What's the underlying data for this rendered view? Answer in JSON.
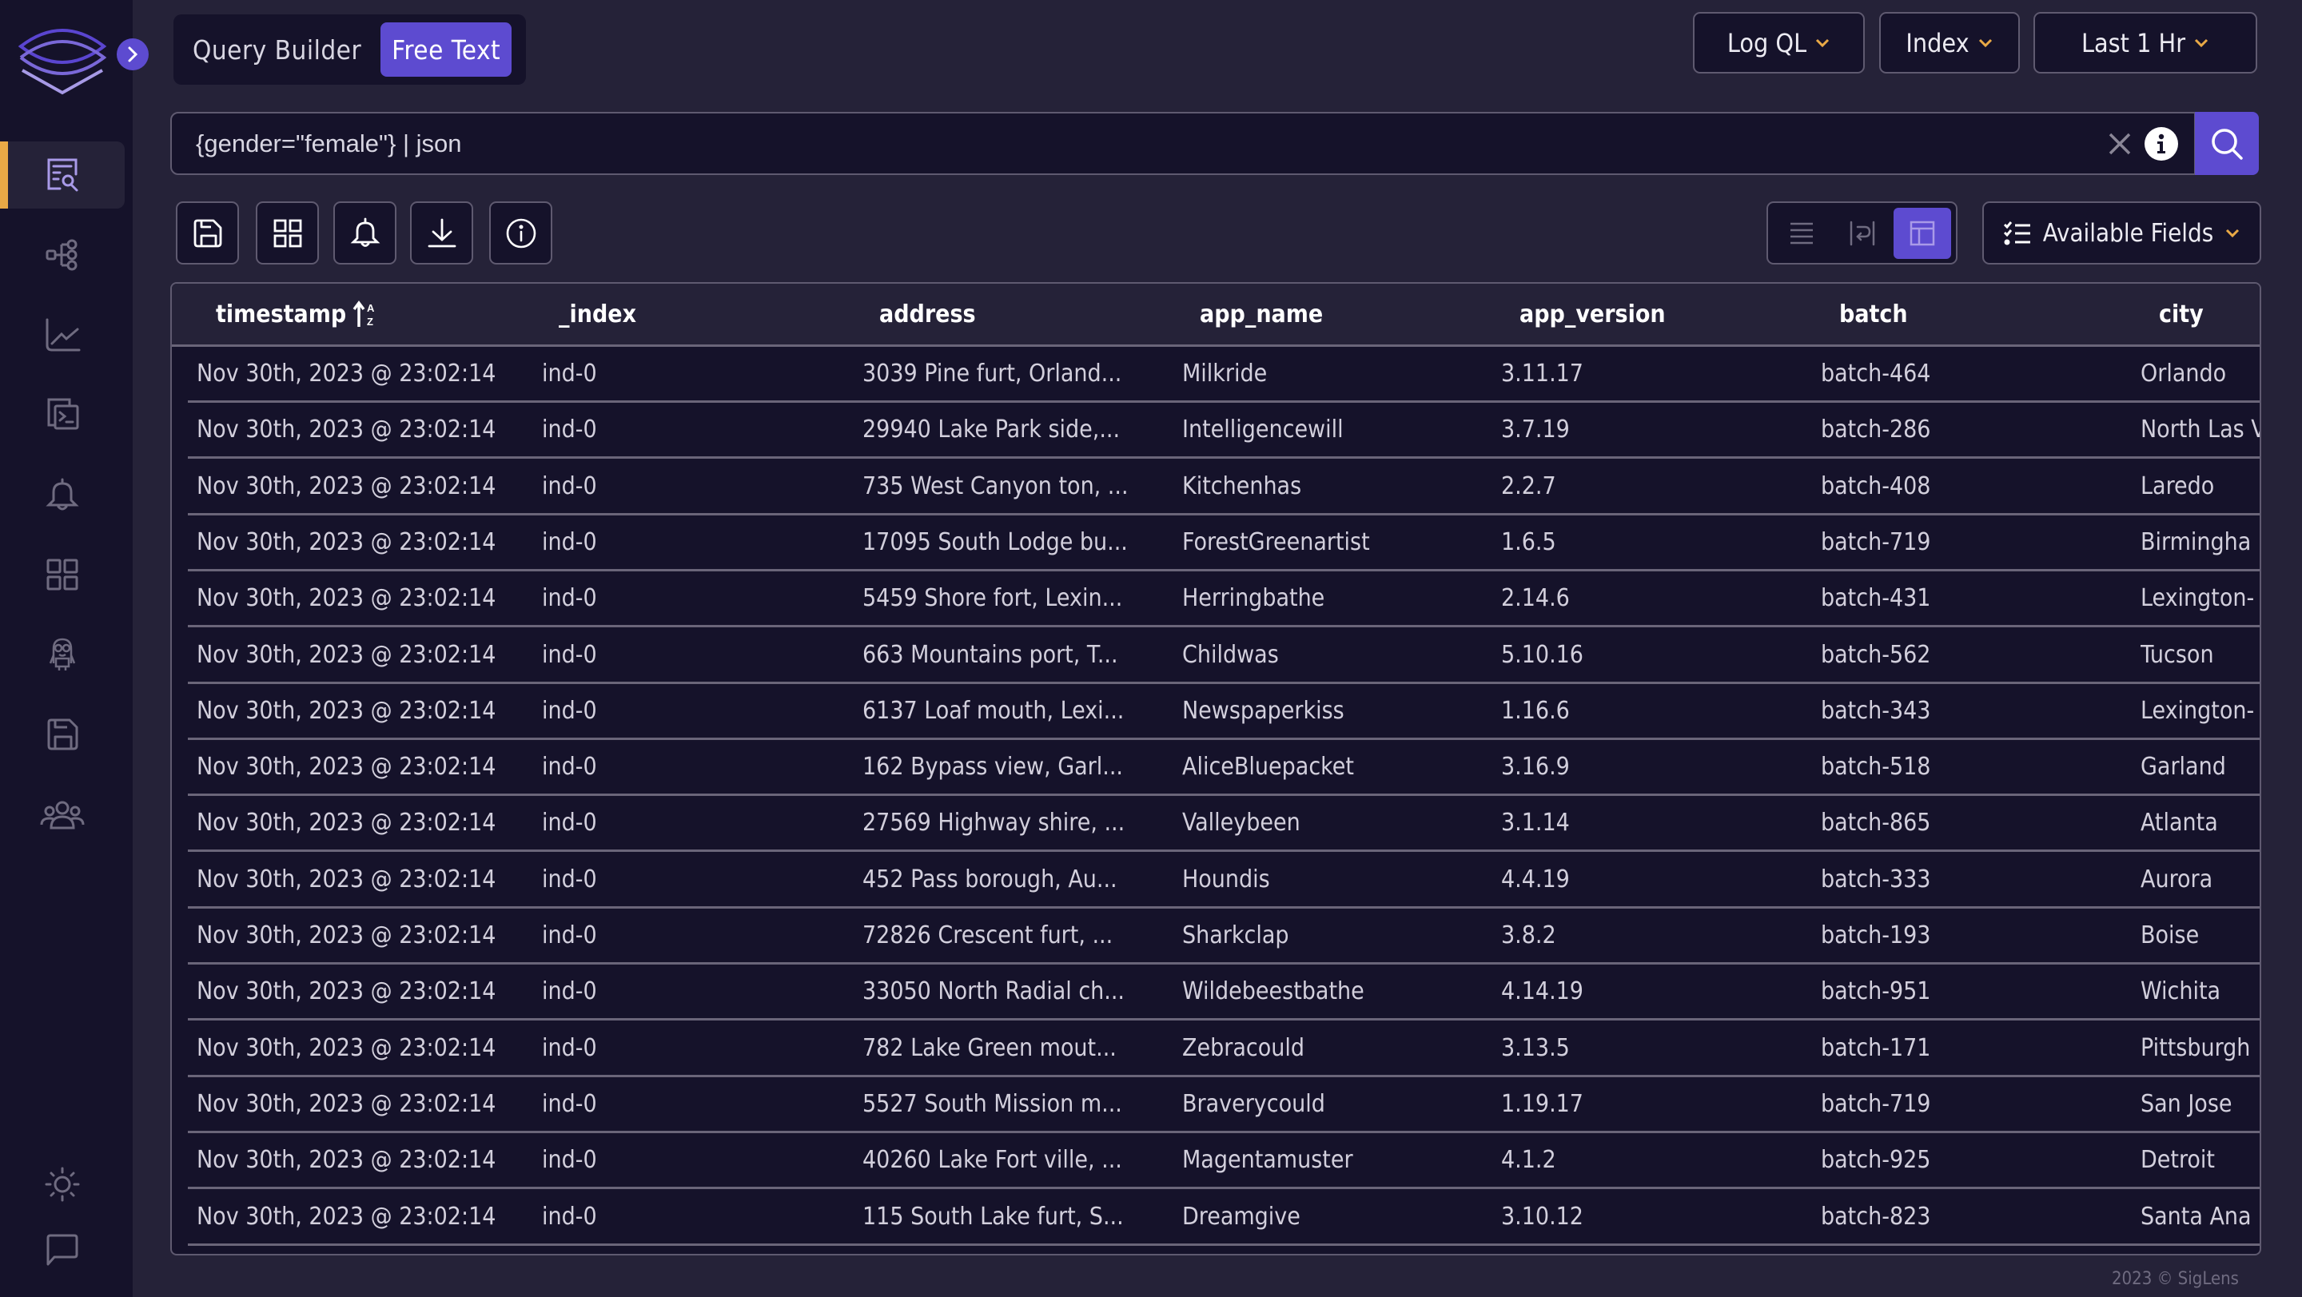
{
  "app": {
    "logo": "siglens-logo",
    "expand_icon": "chevron-right-icon"
  },
  "sidebar": {
    "items": [
      {
        "name": "logs-search",
        "icon": "log-search-icon",
        "active": true
      },
      {
        "name": "service-map",
        "icon": "service-tree-icon",
        "active": false
      },
      {
        "name": "metrics",
        "icon": "line-chart-icon",
        "active": false
      },
      {
        "name": "live-tail",
        "icon": "terminal-icon",
        "active": false
      },
      {
        "name": "alerts",
        "icon": "bell-icon",
        "active": false
      },
      {
        "name": "dashboards",
        "icon": "grid-icon",
        "active": false
      },
      {
        "name": "minion-searches",
        "icon": "minion-icon",
        "active": false
      },
      {
        "name": "saved-queries",
        "icon": "floppy-disk-icon",
        "active": false
      },
      {
        "name": "users",
        "icon": "users-icon",
        "active": false
      }
    ],
    "bottom_items": [
      {
        "name": "theme-toggle",
        "icon": "sun-icon"
      },
      {
        "name": "feedback",
        "icon": "chat-bubble-icon"
      }
    ]
  },
  "query_mode": {
    "tabs": [
      {
        "label": "Query Builder",
        "active": false
      },
      {
        "label": "Free Text",
        "active": true
      }
    ]
  },
  "dropdowns": {
    "query_language": "Log QL",
    "index": "Index",
    "time_range": "Last 1 Hr"
  },
  "search": {
    "value": "{gender=\"female\"} | json",
    "placeholder": ""
  },
  "toolbar": {
    "buttons": [
      {
        "name": "save-query",
        "icon": "floppy-disk-icon"
      },
      {
        "name": "add-to-dashboard",
        "icon": "grid-icon"
      },
      {
        "name": "create-alert",
        "icon": "bell-icon"
      },
      {
        "name": "download",
        "icon": "download-icon"
      },
      {
        "name": "query-info",
        "icon": "info-icon"
      }
    ],
    "view_modes": [
      {
        "name": "single-line",
        "icon": "lines-icon",
        "active": false
      },
      {
        "name": "wrap-lines",
        "icon": "wrap-icon",
        "active": false
      },
      {
        "name": "table",
        "icon": "table-icon",
        "active": true
      }
    ],
    "available_fields_label": "Available Fields"
  },
  "table": {
    "columns": [
      "timestamp",
      "_index",
      "address",
      "app_name",
      "app_version",
      "batch",
      "city"
    ],
    "sort_icon": "sort-ascending-az-icon",
    "rows": [
      [
        "Nov 30th, 2023 @ 23:02:14",
        "ind-0",
        "3039 Pine furt, Orland...",
        "Milkride",
        "3.11.17",
        "batch-464",
        "Orlando"
      ],
      [
        "Nov 30th, 2023 @ 23:02:14",
        "ind-0",
        "29940 Lake Park side,...",
        "Intelligencewill",
        "3.7.19",
        "batch-286",
        "North Las V"
      ],
      [
        "Nov 30th, 2023 @ 23:02:14",
        "ind-0",
        "735 West Canyon ton, ...",
        "Kitchenhas",
        "2.2.7",
        "batch-408",
        "Laredo"
      ],
      [
        "Nov 30th, 2023 @ 23:02:14",
        "ind-0",
        "17095 South Lodge bu...",
        "ForestGreenartist",
        "1.6.5",
        "batch-719",
        "Birmingha"
      ],
      [
        "Nov 30th, 2023 @ 23:02:14",
        "ind-0",
        "5459 Shore fort, Lexin...",
        "Herringbathe",
        "2.14.6",
        "batch-431",
        "Lexington-"
      ],
      [
        "Nov 30th, 2023 @ 23:02:14",
        "ind-0",
        "663 Mountains port, T...",
        "Childwas",
        "5.10.16",
        "batch-562",
        "Tucson"
      ],
      [
        "Nov 30th, 2023 @ 23:02:14",
        "ind-0",
        "6137 Loaf mouth, Lexi...",
        "Newspaperkiss",
        "1.16.6",
        "batch-343",
        "Lexington-"
      ],
      [
        "Nov 30th, 2023 @ 23:02:14",
        "ind-0",
        "162 Bypass view, Garl...",
        "AliceBluepacket",
        "3.16.9",
        "batch-518",
        "Garland"
      ],
      [
        "Nov 30th, 2023 @ 23:02:14",
        "ind-0",
        "27569 Highway shire, ...",
        "Valleybeen",
        "3.1.14",
        "batch-865",
        "Atlanta"
      ],
      [
        "Nov 30th, 2023 @ 23:02:14",
        "ind-0",
        "452 Pass borough, Au...",
        "Houndis",
        "4.4.19",
        "batch-333",
        "Aurora"
      ],
      [
        "Nov 30th, 2023 @ 23:02:14",
        "ind-0",
        "72826 Crescent furt, ...",
        "Sharkclap",
        "3.8.2",
        "batch-193",
        "Boise"
      ],
      [
        "Nov 30th, 2023 @ 23:02:14",
        "ind-0",
        "33050 North Radial ch...",
        "Wildebeestbathe",
        "4.14.19",
        "batch-951",
        "Wichita"
      ],
      [
        "Nov 30th, 2023 @ 23:02:14",
        "ind-0",
        "782 Lake Green mout...",
        "Zebracould",
        "3.13.5",
        "batch-171",
        "Pittsburgh"
      ],
      [
        "Nov 30th, 2023 @ 23:02:14",
        "ind-0",
        "5527 South Mission m...",
        "Braverycould",
        "1.19.17",
        "batch-719",
        "San Jose"
      ],
      [
        "Nov 30th, 2023 @ 23:02:14",
        "ind-0",
        "40260 Lake Fort ville, ...",
        "Magentamuster",
        "4.1.2",
        "batch-925",
        "Detroit"
      ],
      [
        "Nov 30th, 2023 @ 23:02:14",
        "ind-0",
        "115 South Lake furt, S...",
        "Dreamgive",
        "3.10.12",
        "batch-823",
        "Santa Ana"
      ]
    ]
  },
  "footer": {
    "copyright": "2023 © SigLens"
  },
  "colors": {
    "accent": "#5d4bd0",
    "active_indicator": "#e9a946",
    "chevron": "#e9a946",
    "sidebar_bg": "#15122a",
    "main_bg": "#252238"
  }
}
